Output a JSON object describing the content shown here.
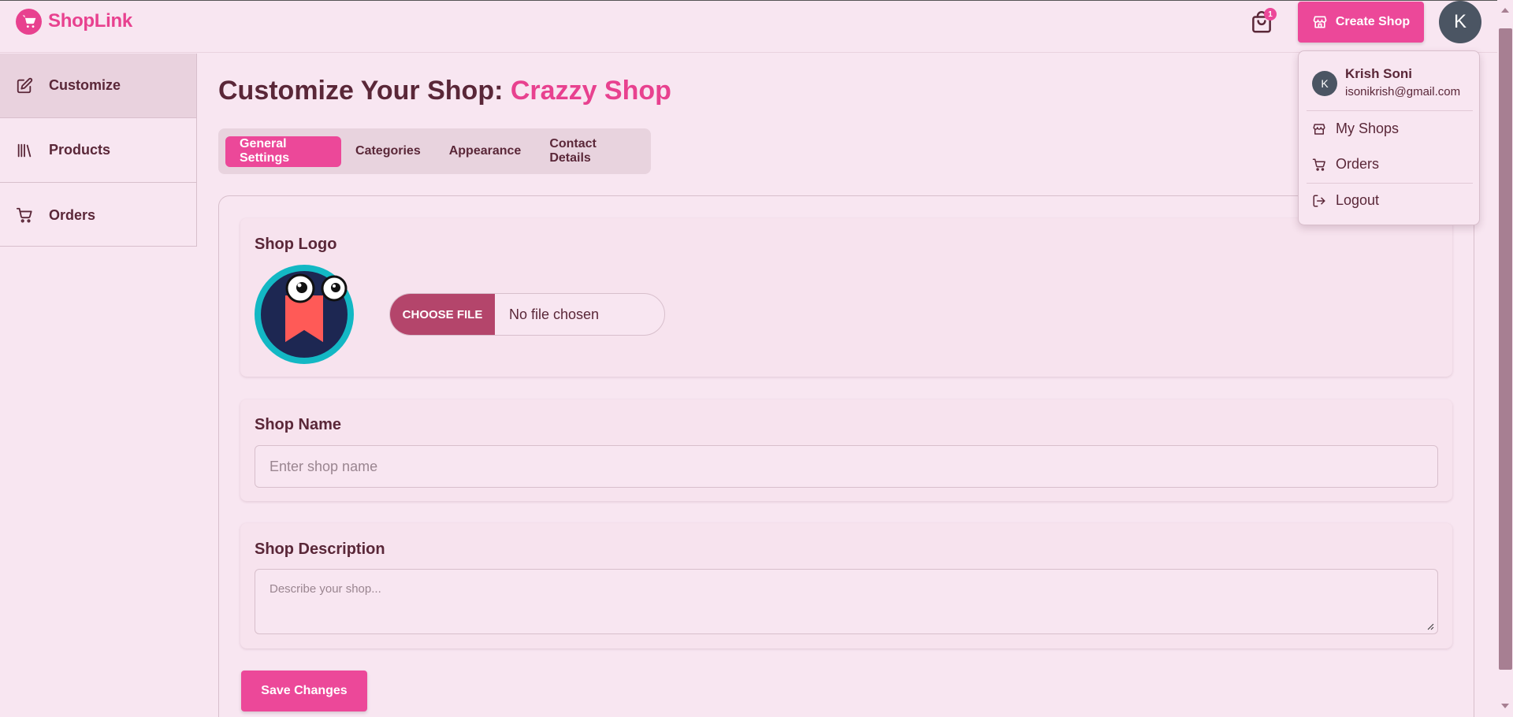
{
  "header": {
    "brand": "ShopLink",
    "cart_count": "1",
    "create_shop_label": "Create Shop",
    "avatar_initial": "K"
  },
  "sidebar": {
    "items": [
      {
        "label": "Customize",
        "icon": "edit-icon",
        "active": true
      },
      {
        "label": "Products",
        "icon": "library-icon",
        "active": false
      },
      {
        "label": "Orders",
        "icon": "cart-icon",
        "active": false
      }
    ]
  },
  "main": {
    "title_prefix": "Customize Your Shop:",
    "shop_name": "Crazzy Shop",
    "tabs": [
      {
        "label": "General Settings",
        "active": true
      },
      {
        "label": "Categories",
        "active": false
      },
      {
        "label": "Appearance",
        "active": false
      },
      {
        "label": "Contact Details",
        "active": false
      }
    ],
    "logo_section": {
      "label": "Shop Logo",
      "choose_file_label": "CHOOSE FILE",
      "file_status": "No file chosen"
    },
    "name_section": {
      "label": "Shop Name",
      "placeholder": "Enter shop name"
    },
    "description_section": {
      "label": "Shop Description",
      "placeholder": "Describe your shop..."
    },
    "save_label": "Save Changes"
  },
  "dropdown": {
    "avatar_initial": "K",
    "user_name": "Krish Soni",
    "user_email": "isonikrish@gmail.com",
    "items": [
      {
        "label": "My Shops",
        "icon": "store-icon"
      },
      {
        "label": "Orders",
        "icon": "cart-icon"
      },
      {
        "label": "Logout",
        "icon": "logout-icon"
      }
    ]
  },
  "colors": {
    "accent": "#ec4899",
    "background": "#f8e6f1",
    "text": "#5a2738",
    "file_button": "#b4456b",
    "avatar": "#4b5563"
  }
}
